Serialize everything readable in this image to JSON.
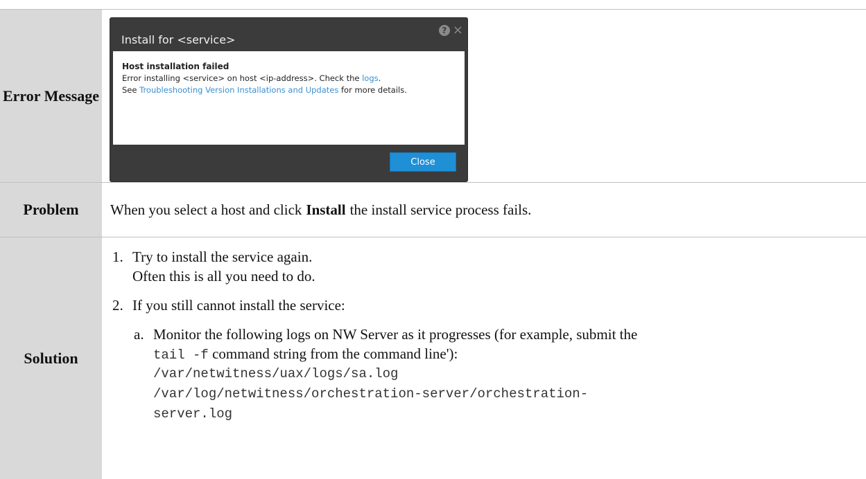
{
  "labels": {
    "error": "Error Message",
    "problem": "Problem",
    "solution": "Solution"
  },
  "dialog": {
    "title": "Install for <service>",
    "heading": "Host installation failed",
    "line1_pre": "Error installing <service>  on host <ip-address>.  Check the ",
    "line1_link": "logs",
    "line1_post": ".",
    "line2_pre": "See ",
    "line2_link": "Troubleshooting Version Installations and Updates",
    "line2_post": " for more details.",
    "close_button": "Close",
    "help_icon": "?",
    "close_icon": "×"
  },
  "problem": {
    "pre": "When you select a host and click",
    "bold": "Install",
    "post": "the install service process fails."
  },
  "solution": {
    "step1_num": "1.",
    "step1_line1": "Try to install the service again.",
    "step1_line2": "Often this is all you need to do.",
    "step2_num": "2.",
    "step2_text": "If you still cannot install the service:",
    "stepa_num": "a.",
    "stepa_line1": "Monitor the following logs on NW Server as it progresses (for example, submit the",
    "stepa_code": "tail -f",
    "stepa_line2_post": " command string from the command line'):",
    "path1": "/var/netwitness/uax/logs/sa.log",
    "path2": "/var/log/netwitness/orchestration-server/orchestration-",
    "path3": "server.log"
  }
}
